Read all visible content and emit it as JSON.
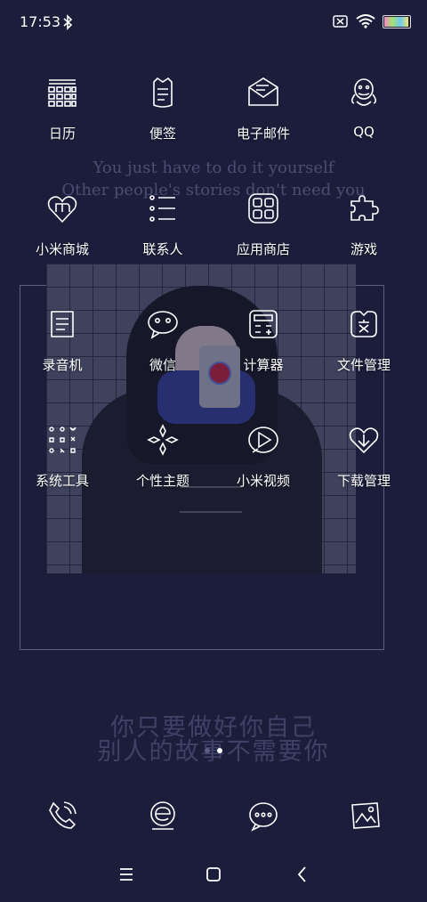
{
  "status": {
    "time": "17:53",
    "battery_level": 0.95,
    "bluetooth_icon": "bluetooth-icon",
    "wifi_icon": "wifi-icon",
    "sim_icon": "no-sim-icon"
  },
  "wallpaper": {
    "quote_en_line1": "You just have to do it yourself",
    "quote_en_line2": "Other people's stories don't need you",
    "quote_cn_line1": "你只要做好你自己",
    "quote_cn_line2": "别人的故事不需要你"
  },
  "apps": [
    {
      "label": "日历",
      "icon": "calendar-icon"
    },
    {
      "label": "便签",
      "icon": "notes-icon"
    },
    {
      "label": "电子邮件",
      "icon": "email-icon"
    },
    {
      "label": "QQ",
      "icon": "qq-icon"
    },
    {
      "label": "小米商城",
      "icon": "mi-store-icon"
    },
    {
      "label": "联系人",
      "icon": "contacts-icon"
    },
    {
      "label": "应用商店",
      "icon": "app-store-icon"
    },
    {
      "label": "游戏",
      "icon": "games-icon"
    },
    {
      "label": "录音机",
      "icon": "recorder-icon"
    },
    {
      "label": "微信",
      "icon": "wechat-icon"
    },
    {
      "label": "计算器",
      "icon": "calculator-icon"
    },
    {
      "label": "文件管理",
      "icon": "file-manager-icon"
    },
    {
      "label": "系统工具",
      "icon": "system-tools-icon"
    },
    {
      "label": "个性主题",
      "icon": "themes-icon"
    },
    {
      "label": "小米视频",
      "icon": "mi-video-icon"
    },
    {
      "label": "下载管理",
      "icon": "downloads-icon"
    }
  ],
  "page_indicator": {
    "pages": 2,
    "current": 2
  },
  "dock": [
    {
      "icon": "phone-icon"
    },
    {
      "icon": "browser-icon"
    },
    {
      "icon": "messages-icon"
    },
    {
      "icon": "gallery-icon"
    }
  ],
  "nav": {
    "menu_icon": "menu-icon",
    "home_icon": "home-icon",
    "back_icon": "back-icon"
  },
  "colors": {
    "background": "#1b1d3b",
    "icon_stroke": "#ffffff",
    "quote_text": "#4a4e72"
  }
}
